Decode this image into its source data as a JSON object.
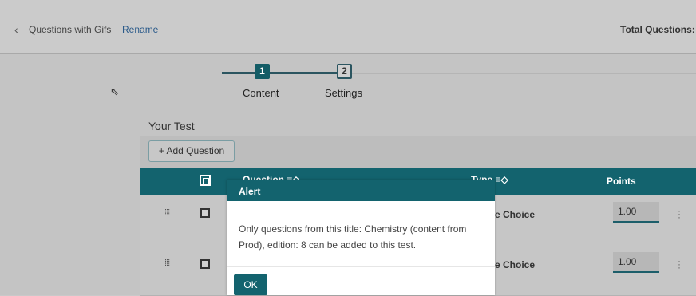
{
  "header": {
    "back_icon": "chevron-left-icon",
    "title": "Questions with Gifs",
    "rename_label": "Rename",
    "total_label": "Total Questions: !"
  },
  "stepper": {
    "steps": [
      {
        "number": "1",
        "label": "Content",
        "active": true
      },
      {
        "number": "2",
        "label": "Settings",
        "active": false
      }
    ],
    "colors": {
      "active": "#135c66",
      "line": "#2b5560"
    }
  },
  "main": {
    "your_test_label": "Your Test",
    "add_question_label": "+ Add Question",
    "table": {
      "headers": {
        "question": "Question ≡◇",
        "type": "Type ≡◇",
        "points": "Points"
      },
      "rows": [
        {
          "type": "iple Choice",
          "points": "1.00"
        },
        {
          "type": "iple Choice",
          "points": "1.00"
        }
      ]
    }
  },
  "alert": {
    "title": "Alert",
    "message": "Only questions from this title: Chemistry (content from Prod), edition: 8 can be added to this test.",
    "ok_label": "OK"
  },
  "colors": {
    "teal": "#13636e",
    "overlay": "#c4c4c4"
  }
}
